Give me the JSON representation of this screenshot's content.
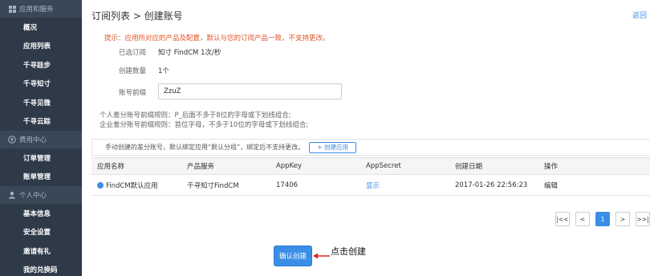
{
  "sidebar": {
    "sections": [
      {
        "head": "应用和服务",
        "icon": "grid-icon",
        "items": [
          "概况",
          "应用列表",
          "千寻跬步",
          "千寻知寸",
          "千寻见微",
          "千寻云踪"
        ]
      },
      {
        "head": "费用中心",
        "icon": "yen-icon",
        "items": [
          "订单管理",
          "账单管理"
        ]
      },
      {
        "head": "个人中心",
        "icon": "user-icon",
        "items": [
          "基本信息",
          "安全设置",
          "邀请有礼",
          "我的兑换码"
        ]
      }
    ]
  },
  "header": {
    "title": "订阅列表 > 创建账号",
    "back": "返回"
  },
  "hint": "提示：应用所对应的产品及配置，默认与您的订阅产品一致，不支持更改。",
  "form": {
    "subscribed_label": "已选订阅",
    "subscribed_value": "知寸 FindCM 1次/秒",
    "count_label": "创建数量",
    "count_value": "1个",
    "prefix_label": "账号前缀",
    "prefix_value": "ZzuZ",
    "rule_personal": "个人差分账号前缀规则：P_后面不多于8位的字母或下划线组合;",
    "rule_enterprise": "企业差分账号前缀规则：首位字母，不多于10位的字母或下划线组合;"
  },
  "info_bar": {
    "text": "手动创建的差分账号，默认绑定应用“默认分组”，绑定后不支持更改。",
    "button": "+ 创建应用"
  },
  "table": {
    "headers": [
      "应用名称",
      "产品服务",
      "AppKey",
      "AppSecret",
      "创建日期",
      "操作"
    ],
    "rows": [
      {
        "name": "FindCM默认应用",
        "service": "千寻知寸FindCM",
        "appkey": "17406",
        "secret": "显示",
        "date": "2017-01-26 22:56:23",
        "action": "编辑"
      }
    ]
  },
  "pager": {
    "first": "|<<",
    "prev": "<",
    "current": "1",
    "next": ">",
    "last": ">>|"
  },
  "confirm_button": "确认创建",
  "annotation": "点击创建",
  "colors": {
    "sidebar_bg": "#2e3a48",
    "accent": "#3a8ee6",
    "hint": "#e0562a",
    "arrow": "#e02020"
  }
}
